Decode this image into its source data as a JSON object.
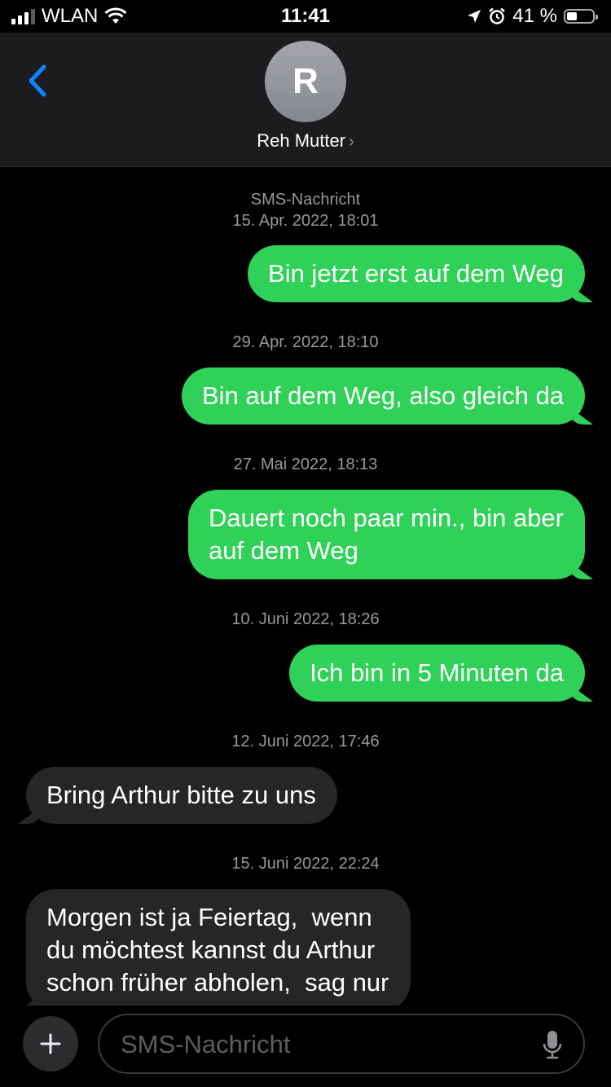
{
  "status_bar": {
    "carrier": "WLAN",
    "time": "11:41",
    "battery_percent": "41 %",
    "battery_level": 0.41
  },
  "header": {
    "avatar_initial": "R",
    "contact_name": "Reh Mutter",
    "chevron": "›"
  },
  "messages": [
    {
      "type": "timestamp",
      "lines": [
        "SMS-Nachricht",
        "15. Apr. 2022, 18:01"
      ]
    },
    {
      "type": "outgoing",
      "text": "Bin jetzt erst auf dem Weg"
    },
    {
      "type": "timestamp",
      "lines": [
        "29. Apr. 2022, 18:10"
      ]
    },
    {
      "type": "outgoing",
      "text": "Bin auf dem Weg, also gleich da"
    },
    {
      "type": "timestamp",
      "lines": [
        "27. Mai 2022, 18:13"
      ]
    },
    {
      "type": "outgoing",
      "text": "Dauert noch paar min., bin aber\nauf dem Weg"
    },
    {
      "type": "timestamp",
      "lines": [
        "10. Juni 2022, 18:26"
      ]
    },
    {
      "type": "outgoing",
      "text": "Ich bin in 5 Minuten da"
    },
    {
      "type": "timestamp",
      "lines": [
        "12. Juni 2022, 17:46"
      ]
    },
    {
      "type": "incoming",
      "text": "Bring Arthur bitte zu uns"
    },
    {
      "type": "timestamp",
      "lines": [
        "15. Juni 2022, 22:24"
      ]
    },
    {
      "type": "incoming",
      "text": "Morgen ist ja Feiertag,  wenn\ndu möchtest kannst du Arthur\nschon früher abholen,  sag nur"
    }
  ],
  "composer": {
    "placeholder": "SMS-Nachricht"
  },
  "colors": {
    "outgoing_bubble": "#30d158",
    "incoming_bubble": "#262629",
    "accent": "#0a84ff"
  },
  "icons": [
    "back-chevron-icon",
    "wifi-icon",
    "location-icon",
    "alarm-icon",
    "plus-icon",
    "microphone-icon"
  ]
}
